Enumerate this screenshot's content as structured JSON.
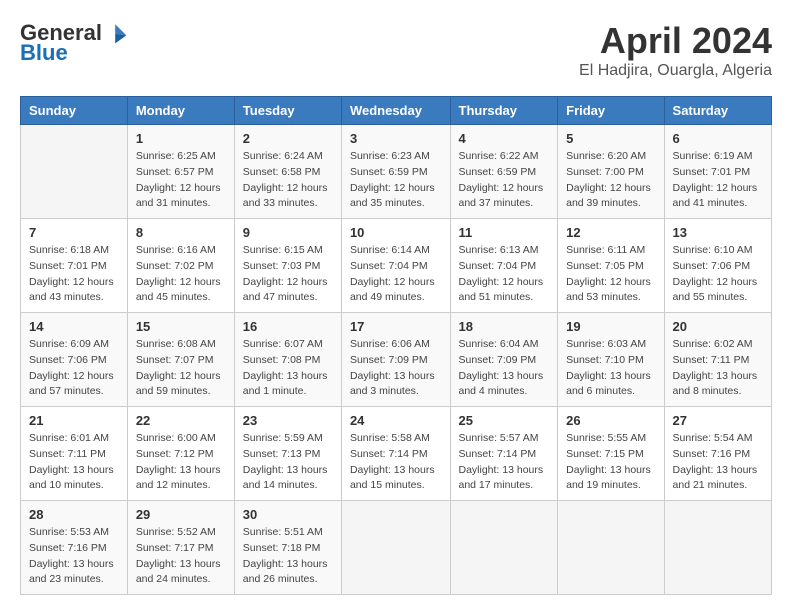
{
  "header": {
    "logo_general": "General",
    "logo_blue": "Blue",
    "title": "April 2024",
    "subtitle": "El Hadjira, Ouargla, Algeria"
  },
  "calendar": {
    "days_of_week": [
      "Sunday",
      "Monday",
      "Tuesday",
      "Wednesday",
      "Thursday",
      "Friday",
      "Saturday"
    ],
    "weeks": [
      [
        {
          "day": "",
          "info": ""
        },
        {
          "day": "1",
          "info": "Sunrise: 6:25 AM\nSunset: 6:57 PM\nDaylight: 12 hours\nand 31 minutes."
        },
        {
          "day": "2",
          "info": "Sunrise: 6:24 AM\nSunset: 6:58 PM\nDaylight: 12 hours\nand 33 minutes."
        },
        {
          "day": "3",
          "info": "Sunrise: 6:23 AM\nSunset: 6:59 PM\nDaylight: 12 hours\nand 35 minutes."
        },
        {
          "day": "4",
          "info": "Sunrise: 6:22 AM\nSunset: 6:59 PM\nDaylight: 12 hours\nand 37 minutes."
        },
        {
          "day": "5",
          "info": "Sunrise: 6:20 AM\nSunset: 7:00 PM\nDaylight: 12 hours\nand 39 minutes."
        },
        {
          "day": "6",
          "info": "Sunrise: 6:19 AM\nSunset: 7:01 PM\nDaylight: 12 hours\nand 41 minutes."
        }
      ],
      [
        {
          "day": "7",
          "info": "Sunrise: 6:18 AM\nSunset: 7:01 PM\nDaylight: 12 hours\nand 43 minutes."
        },
        {
          "day": "8",
          "info": "Sunrise: 6:16 AM\nSunset: 7:02 PM\nDaylight: 12 hours\nand 45 minutes."
        },
        {
          "day": "9",
          "info": "Sunrise: 6:15 AM\nSunset: 7:03 PM\nDaylight: 12 hours\nand 47 minutes."
        },
        {
          "day": "10",
          "info": "Sunrise: 6:14 AM\nSunset: 7:04 PM\nDaylight: 12 hours\nand 49 minutes."
        },
        {
          "day": "11",
          "info": "Sunrise: 6:13 AM\nSunset: 7:04 PM\nDaylight: 12 hours\nand 51 minutes."
        },
        {
          "day": "12",
          "info": "Sunrise: 6:11 AM\nSunset: 7:05 PM\nDaylight: 12 hours\nand 53 minutes."
        },
        {
          "day": "13",
          "info": "Sunrise: 6:10 AM\nSunset: 7:06 PM\nDaylight: 12 hours\nand 55 minutes."
        }
      ],
      [
        {
          "day": "14",
          "info": "Sunrise: 6:09 AM\nSunset: 7:06 PM\nDaylight: 12 hours\nand 57 minutes."
        },
        {
          "day": "15",
          "info": "Sunrise: 6:08 AM\nSunset: 7:07 PM\nDaylight: 12 hours\nand 59 minutes."
        },
        {
          "day": "16",
          "info": "Sunrise: 6:07 AM\nSunset: 7:08 PM\nDaylight: 13 hours\nand 1 minute."
        },
        {
          "day": "17",
          "info": "Sunrise: 6:06 AM\nSunset: 7:09 PM\nDaylight: 13 hours\nand 3 minutes."
        },
        {
          "day": "18",
          "info": "Sunrise: 6:04 AM\nSunset: 7:09 PM\nDaylight: 13 hours\nand 4 minutes."
        },
        {
          "day": "19",
          "info": "Sunrise: 6:03 AM\nSunset: 7:10 PM\nDaylight: 13 hours\nand 6 minutes."
        },
        {
          "day": "20",
          "info": "Sunrise: 6:02 AM\nSunset: 7:11 PM\nDaylight: 13 hours\nand 8 minutes."
        }
      ],
      [
        {
          "day": "21",
          "info": "Sunrise: 6:01 AM\nSunset: 7:11 PM\nDaylight: 13 hours\nand 10 minutes."
        },
        {
          "day": "22",
          "info": "Sunrise: 6:00 AM\nSunset: 7:12 PM\nDaylight: 13 hours\nand 12 minutes."
        },
        {
          "day": "23",
          "info": "Sunrise: 5:59 AM\nSunset: 7:13 PM\nDaylight: 13 hours\nand 14 minutes."
        },
        {
          "day": "24",
          "info": "Sunrise: 5:58 AM\nSunset: 7:14 PM\nDaylight: 13 hours\nand 15 minutes."
        },
        {
          "day": "25",
          "info": "Sunrise: 5:57 AM\nSunset: 7:14 PM\nDaylight: 13 hours\nand 17 minutes."
        },
        {
          "day": "26",
          "info": "Sunrise: 5:55 AM\nSunset: 7:15 PM\nDaylight: 13 hours\nand 19 minutes."
        },
        {
          "day": "27",
          "info": "Sunrise: 5:54 AM\nSunset: 7:16 PM\nDaylight: 13 hours\nand 21 minutes."
        }
      ],
      [
        {
          "day": "28",
          "info": "Sunrise: 5:53 AM\nSunset: 7:16 PM\nDaylight: 13 hours\nand 23 minutes."
        },
        {
          "day": "29",
          "info": "Sunrise: 5:52 AM\nSunset: 7:17 PM\nDaylight: 13 hours\nand 24 minutes."
        },
        {
          "day": "30",
          "info": "Sunrise: 5:51 AM\nSunset: 7:18 PM\nDaylight: 13 hours\nand 26 minutes."
        },
        {
          "day": "",
          "info": ""
        },
        {
          "day": "",
          "info": ""
        },
        {
          "day": "",
          "info": ""
        },
        {
          "day": "",
          "info": ""
        }
      ]
    ]
  }
}
